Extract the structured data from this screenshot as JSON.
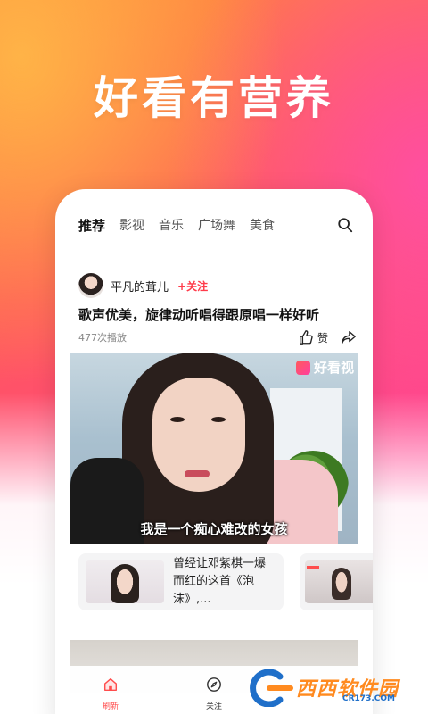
{
  "hero": {
    "title": "好看有营养"
  },
  "tabs": [
    {
      "label": "推荐",
      "active": true
    },
    {
      "label": "影视"
    },
    {
      "label": "音乐"
    },
    {
      "label": "广场舞"
    },
    {
      "label": "美食"
    }
  ],
  "post": {
    "author": "平凡的茸儿",
    "follow_label": "+关注",
    "title": "歌声优美，旋律动听唱得跟原唱一样好听",
    "plays": "477次播放",
    "like_label": "赞",
    "video": {
      "logo_text": "好看视",
      "subtitle": "我是一个痴心难改的女孩"
    }
  },
  "recommendations": [
    {
      "title": "曾经让邓紫棋一爆而红的这首《泡沫》,..."
    }
  ],
  "bottom_nav": [
    {
      "label": "刷新",
      "icon": "home-icon",
      "active": true
    },
    {
      "label": "关注",
      "icon": "compass-icon"
    }
  ],
  "watermark": {
    "text": "西西软件园",
    "sub": "CR173.COM"
  },
  "colors": {
    "accent": "#ff3b4a",
    "brand_orange": "#ff8a3a",
    "brand_pink": "#ff3f8c"
  }
}
